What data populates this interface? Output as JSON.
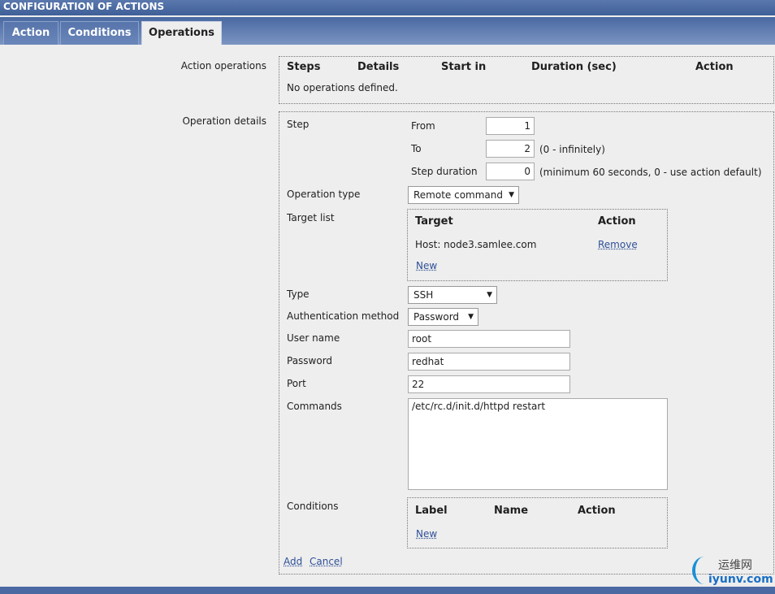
{
  "header": {
    "title": "CONFIGURATION OF ACTIONS"
  },
  "tabs": [
    {
      "label": "Action"
    },
    {
      "label": "Conditions"
    },
    {
      "label": "Operations"
    }
  ],
  "action_operations": {
    "label": "Action operations",
    "columns": [
      "Steps",
      "Details",
      "Start in",
      "Duration (sec)",
      "Action"
    ],
    "empty": "No operations defined."
  },
  "operation_details": {
    "label": "Operation details",
    "step": {
      "label": "Step",
      "from_label": "From",
      "from": "1",
      "to_label": "To",
      "to": "2",
      "to_hint": "(0 - infinitely)",
      "duration_label": "Step duration",
      "duration": "0",
      "duration_hint": "(minimum 60 seconds, 0 - use action default)"
    },
    "operation_type": {
      "label": "Operation type",
      "value": "Remote command"
    },
    "target_list": {
      "label": "Target list",
      "columns": [
        "Target",
        "Action"
      ],
      "rows": [
        {
          "target": "Host: node3.samlee.com",
          "action": "Remove"
        }
      ],
      "new": "New"
    },
    "type": {
      "label": "Type",
      "value": "SSH"
    },
    "auth": {
      "label": "Authentication method",
      "value": "Password"
    },
    "username": {
      "label": "User name",
      "value": "root"
    },
    "password": {
      "label": "Password",
      "value": "redhat"
    },
    "port": {
      "label": "Port",
      "value": "22"
    },
    "commands": {
      "label": "Commands",
      "value": "/etc/rc.d/init.d/httpd restart"
    },
    "conditions": {
      "label": "Conditions",
      "columns": [
        "Label",
        "Name",
        "Action"
      ],
      "new": "New"
    },
    "add": "Add",
    "cancel": "Cancel"
  },
  "watermark": {
    "cn": "运维网",
    "en": "iyunv.com"
  }
}
